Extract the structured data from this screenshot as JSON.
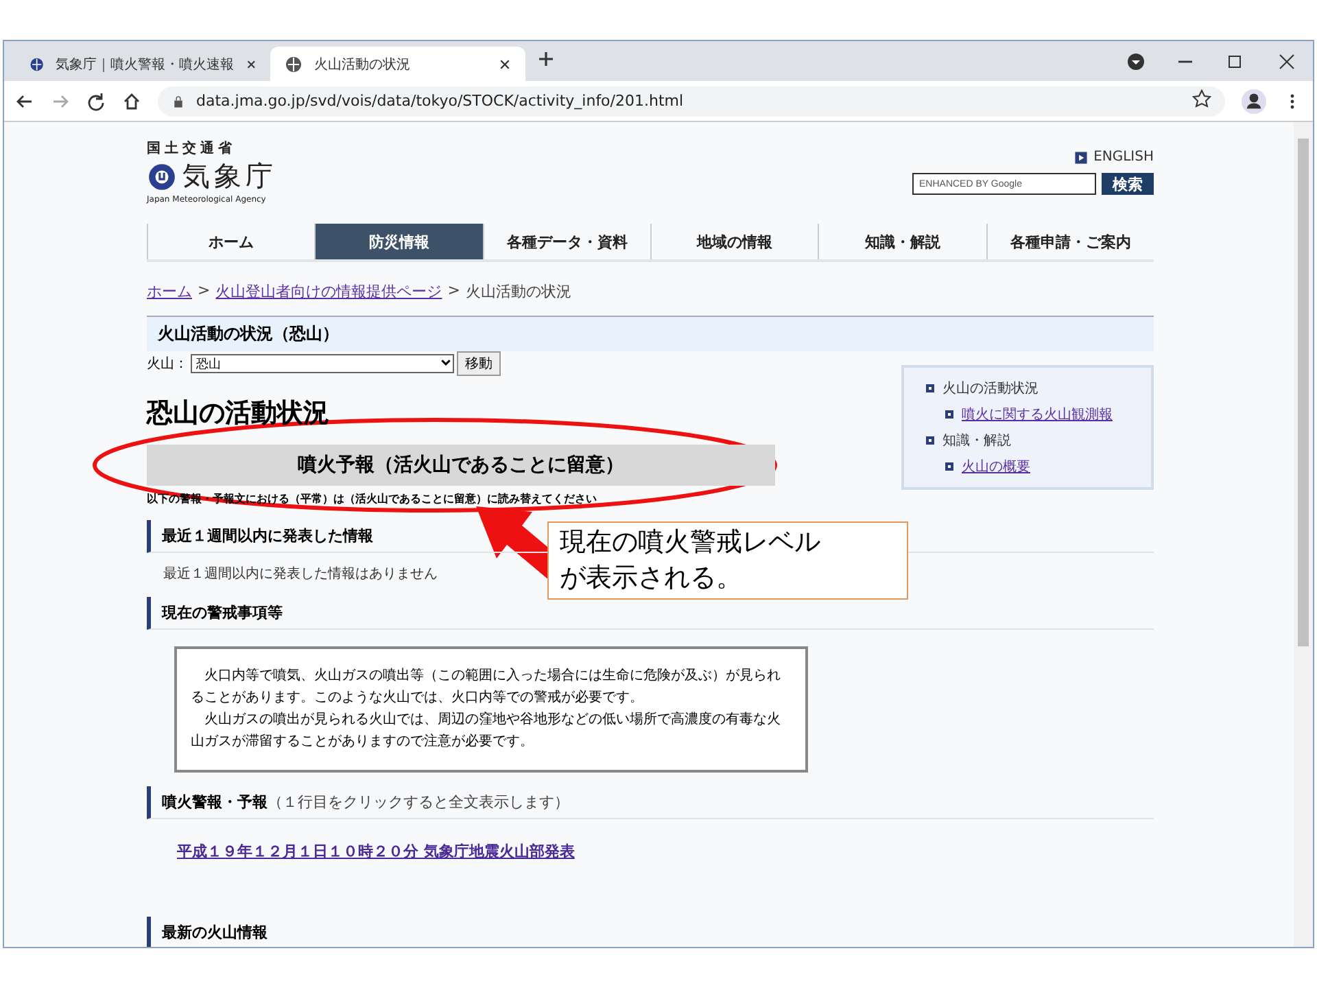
{
  "browser": {
    "tabs": [
      {
        "title": "気象庁｜噴火警報・噴火速報",
        "selected": false
      },
      {
        "title": "火山活動の状況",
        "selected": true
      }
    ],
    "url": "data.jma.go.jp/svd/vois/data/tokyo/STOCK/activity_info/201.html"
  },
  "header": {
    "ministry": "国土交通省",
    "agency": "気象庁",
    "agency_en": "Japan Meteorological Agency",
    "english_link": "ENGLISH",
    "search_placeholder": "ENHANCED BY Google",
    "search_button": "検索"
  },
  "nav": [
    {
      "label": "ホーム",
      "selected": false
    },
    {
      "label": "防災情報",
      "selected": true
    },
    {
      "label": "各種データ・資料",
      "selected": false
    },
    {
      "label": "地域の情報",
      "selected": false
    },
    {
      "label": "知識・解説",
      "selected": false
    },
    {
      "label": "各種申請・ご案内",
      "selected": false
    }
  ],
  "breadcrumb": [
    {
      "kind": "link",
      "label": "ホーム"
    },
    {
      "kind": "separator",
      "label": ">"
    },
    {
      "kind": "link",
      "label": "火山登山者向けの情報提供ページ"
    },
    {
      "kind": "separator",
      "label": ">"
    },
    {
      "kind": "current",
      "label": "火山活動の状況"
    }
  ],
  "page": {
    "section_title": "火山活動の状況（恐山）",
    "select_label": "火山：",
    "select_value": "恐山",
    "move_button": "移動",
    "heading": "恐山の活動状況",
    "alert_banner": "噴火予報（活火山であることに留意）",
    "notice": "以下の警報・予報文における（平常）は（活火山であることに留意）に読み替えてください",
    "sections": [
      {
        "kind": "text",
        "title": "最近１週間以内に発表した情報",
        "content": [
          "最近１週間以内に発表した情報はありません"
        ]
      },
      {
        "kind": "box",
        "title": "現在の警戒事項等",
        "content": [
          "火口内等で噴気、火山ガスの噴出等（この範囲に入った場合には生命に危険が及ぶ）が見られることがあります。このような火山では、火口内等での警戒が必要です。",
          "火山ガスの噴出が見られる火山では、周辺の窪地や谷地形などの低い場所で高濃度の有毒な火山ガスが滞留することがありますので注意が必要です。"
        ]
      },
      {
        "kind": "link",
        "title": "噴火警報・予報",
        "note": "（１行目をクリックすると全文表示します）",
        "content": [
          "平成１９年１２月１日１０時２０分 気象庁地震火山部発表"
        ]
      },
      {
        "kind": "empty",
        "title": "最新の火山情報"
      }
    ]
  },
  "side_menu": [
    {
      "label": "火山の活動状況",
      "link": false,
      "children": [
        {
          "label": "噴火に関する火山観測報",
          "link": true
        }
      ]
    },
    {
      "label": "知識・解説",
      "link": false,
      "children": [
        {
          "label": "火山の概要",
          "link": true
        }
      ]
    }
  ],
  "annotation": {
    "callout": "現在の噴火警戒レベルが表示される。"
  }
}
